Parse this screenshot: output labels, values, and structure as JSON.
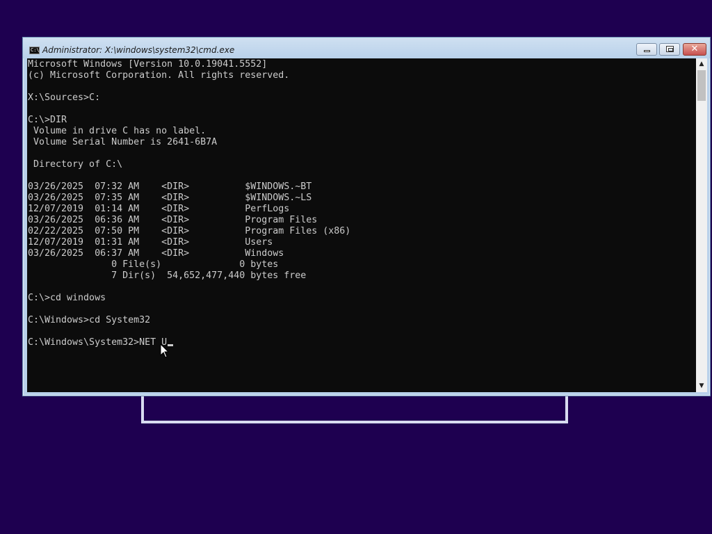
{
  "window": {
    "title": "Administrator: X:\\windows\\system32\\cmd.exe",
    "icon_text": "C:\\",
    "buttons": {
      "minimize": "minimize-icon",
      "maximize": "maximize-icon",
      "close": "✕"
    }
  },
  "console": {
    "lines": [
      "Microsoft Windows [Version 10.0.19041.5552]",
      "(c) Microsoft Corporation. All rights reserved.",
      "",
      "X:\\Sources>C:",
      "",
      "C:\\>DIR",
      " Volume in drive C has no label.",
      " Volume Serial Number is 2641-6B7A",
      "",
      " Directory of C:\\",
      "",
      "03/26/2025  07:32 AM    <DIR>          $WINDOWS.~BT",
      "03/26/2025  07:35 AM    <DIR>          $WINDOWS.~LS",
      "12/07/2019  01:14 AM    <DIR>          PerfLogs",
      "03/26/2025  06:36 AM    <DIR>          Program Files",
      "02/22/2025  07:50 PM    <DIR>          Program Files (x86)",
      "12/07/2019  01:31 AM    <DIR>          Users",
      "03/26/2025  06:37 AM    <DIR>          Windows",
      "               0 File(s)              0 bytes",
      "               7 Dir(s)  54,652,477,440 bytes free",
      "",
      "C:\\>cd windows",
      "",
      "C:\\Windows>cd System32",
      "",
      "C:\\Windows\\System32>NET U"
    ]
  },
  "colors": {
    "desktop": "#1e0050",
    "console_bg": "#0c0c0c",
    "console_fg": "#cccccc"
  }
}
